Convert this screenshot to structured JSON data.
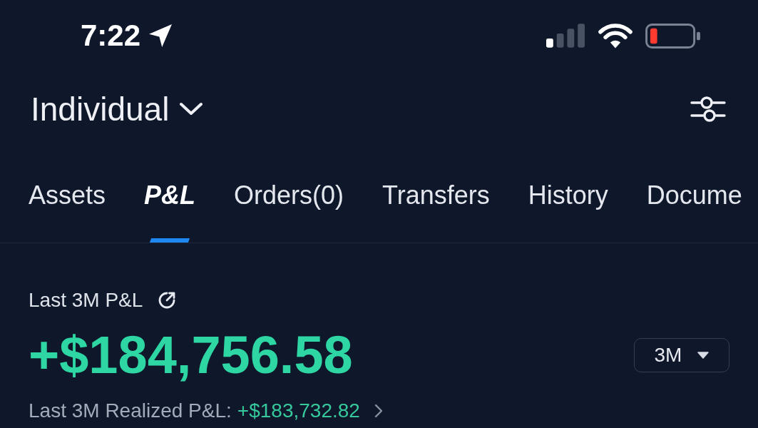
{
  "status_bar": {
    "time": "7:22"
  },
  "header": {
    "account": "Individual"
  },
  "tabs": [
    {
      "label": "Assets",
      "selected": false
    },
    {
      "label": "P&L",
      "selected": true
    },
    {
      "label": "Orders(0)",
      "selected": false
    },
    {
      "label": "Transfers",
      "selected": false
    },
    {
      "label": "History",
      "selected": false
    },
    {
      "label": "Docume",
      "selected": false
    }
  ],
  "pnl": {
    "title": "Last 3M P&L",
    "value": "+$184,756.58",
    "period": "3M",
    "realized_label": "Last 3M Realized P&L:",
    "realized_value": "+$183,732.82"
  }
}
